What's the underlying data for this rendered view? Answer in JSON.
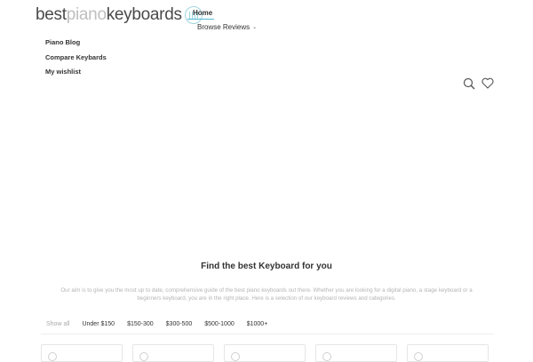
{
  "header": {
    "logo": {
      "part1": "best",
      "part2": "piano",
      "part3": "keyboards"
    },
    "nav": {
      "home": "Home",
      "browse_reviews": "Browse Reviews"
    },
    "side_links": [
      "Piano Blog",
      "Compare Keybards",
      "My wishlist"
    ],
    "icons": [
      "search-icon",
      "heart-icon"
    ]
  },
  "main": {
    "title": "Find the best Keyboard for you",
    "intro": "Our aim is to give you the most up to date, comprehensive guide of the best piano keyboards out there. Whether you are looking for a digital piano, a stage keyboard or a beginners keyboard, you are in the right place. Here is a selection of our keyboard reviews and categories.",
    "filters": [
      {
        "label": "Show all",
        "active": true
      },
      {
        "label": "Under $150",
        "active": false
      },
      {
        "label": "$150-300",
        "active": false
      },
      {
        "label": "$300-500",
        "active": false
      },
      {
        "label": "$500-1000",
        "active": false
      },
      {
        "label": "$1000+",
        "active": false
      }
    ]
  },
  "colors": {
    "accent": "#54b9d1",
    "logo_mark": "#9fd6e0",
    "muted_text": "#b4b4b4"
  }
}
